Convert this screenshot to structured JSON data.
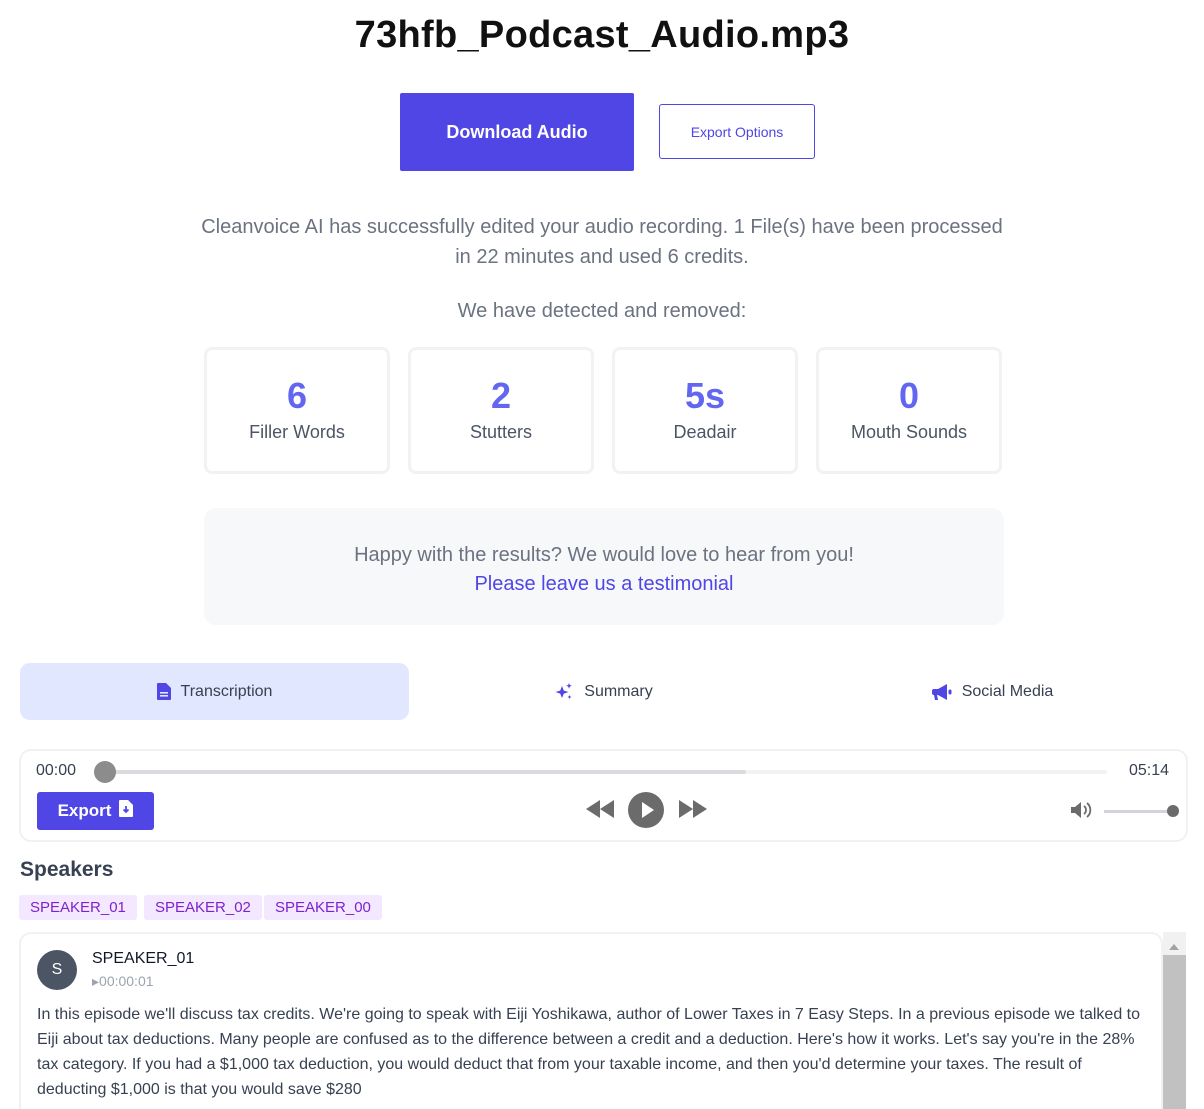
{
  "file_title": "73hfb_Podcast_Audio.mp3",
  "actions": {
    "download_label": "Download Audio",
    "export_options_label": "Export Options"
  },
  "result_message": "Cleanvoice AI has successfully edited your audio recording. 1 File(s) have been processed in 22 minutes and used 6 credits.",
  "detected_heading": "We have detected and removed:",
  "stats": [
    {
      "value": "6",
      "label": "Filler Words"
    },
    {
      "value": "2",
      "label": "Stutters"
    },
    {
      "value": "5s",
      "label": "Deadair"
    },
    {
      "value": "0",
      "label": "Mouth Sounds"
    }
  ],
  "feedback": {
    "question": "Happy with the results? We would love to hear from you!",
    "link_label": "Please leave us a testimonial"
  },
  "tabs": [
    {
      "label": "Transcription",
      "icon": "document-icon",
      "active": true
    },
    {
      "label": "Summary",
      "icon": "sparkles-icon",
      "active": false
    },
    {
      "label": "Social Media",
      "icon": "megaphone-icon",
      "active": false
    }
  ],
  "player": {
    "current_time": "00:00",
    "total_time": "05:14",
    "progress": 0.0,
    "buffered": 0.64,
    "volume": 1.0,
    "export_label": "Export"
  },
  "speakers_heading": "Speakers",
  "speakers": [
    "SPEAKER_01",
    "SPEAKER_02",
    "SPEAKER_00"
  ],
  "transcript": {
    "avatar_letter": "S",
    "speaker": "SPEAKER_01",
    "timestamp": "▸00:00:01",
    "text": "In this episode we'll discuss tax credits. We're going to speak with Eiji Yoshikawa, author of Lower Taxes in 7 Easy Steps. In a previous episode we talked to Eiji about tax deductions. Many people are confused as to the difference between a credit and a deduction. Here's how it works. Let's say you're in the 28% tax category. If you had a $1,000 tax deduction, you would deduct that from your taxable income, and then you'd determine your taxes. The result of deducting $1,000 is that you would save $280"
  },
  "colors": {
    "accent": "#4f46e5",
    "stat_number": "#6366f1",
    "active_tab_bg": "#e0e7ff",
    "chip_bg": "#f3e8ff",
    "chip_text": "#7e22ce"
  }
}
